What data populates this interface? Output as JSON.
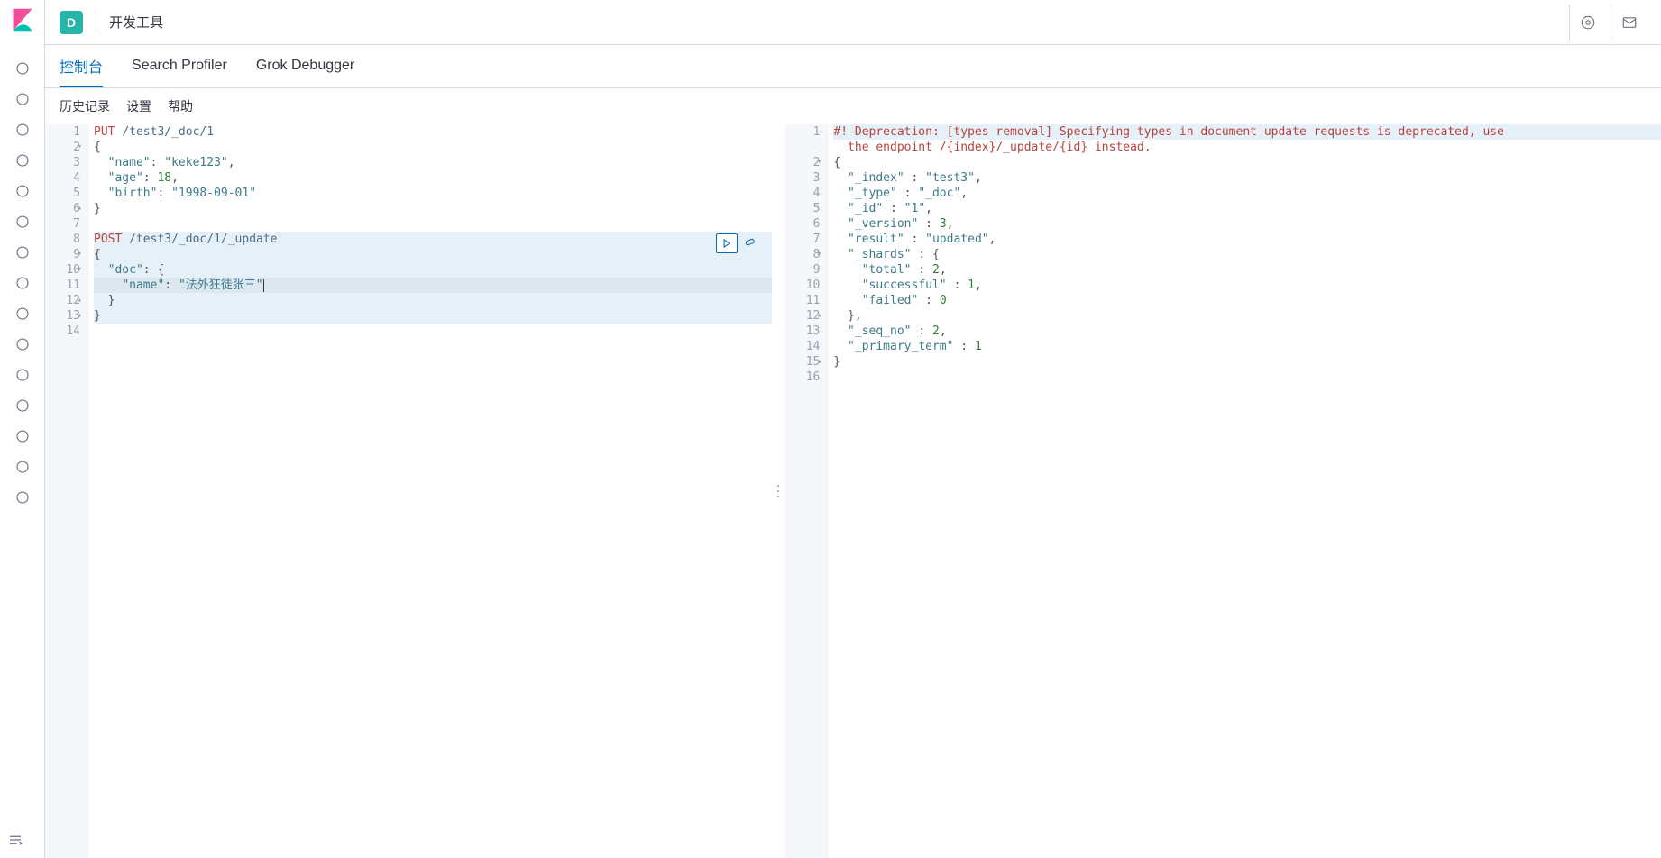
{
  "header": {
    "space_initial": "D",
    "breadcrumb": "开发工具"
  },
  "tabs": [
    {
      "label": "控制台",
      "active": true
    },
    {
      "label": "Search Profiler",
      "active": false
    },
    {
      "label": "Grok Debugger",
      "active": false
    }
  ],
  "subbar": {
    "history": "历史记录",
    "settings": "设置",
    "help": "帮助"
  },
  "editor": {
    "active_block_start": 8,
    "active_block_end": 13,
    "cursor_line": 11,
    "lines": [
      {
        "n": 1,
        "fold": "",
        "tokens": [
          [
            "method",
            "PUT"
          ],
          [
            "text",
            " "
          ],
          [
            "path",
            "/test3/_doc/1"
          ]
        ]
      },
      {
        "n": 2,
        "fold": "▾",
        "tokens": [
          [
            "punct",
            "{"
          ]
        ]
      },
      {
        "n": 3,
        "fold": "",
        "tokens": [
          [
            "text",
            "  "
          ],
          [
            "key",
            "\"name\""
          ],
          [
            "punct",
            ": "
          ],
          [
            "str",
            "\"keke123\""
          ],
          [
            "punct",
            ","
          ]
        ]
      },
      {
        "n": 4,
        "fold": "",
        "tokens": [
          [
            "text",
            "  "
          ],
          [
            "key",
            "\"age\""
          ],
          [
            "punct",
            ": "
          ],
          [
            "num",
            "18"
          ],
          [
            "punct",
            ","
          ]
        ]
      },
      {
        "n": 5,
        "fold": "",
        "tokens": [
          [
            "text",
            "  "
          ],
          [
            "key",
            "\"birth\""
          ],
          [
            "punct",
            ": "
          ],
          [
            "str",
            "\"1998-09-01\""
          ]
        ]
      },
      {
        "n": 6,
        "fold": "▴",
        "tokens": [
          [
            "punct",
            "}"
          ]
        ]
      },
      {
        "n": 7,
        "fold": "",
        "tokens": []
      },
      {
        "n": 8,
        "fold": "",
        "tokens": [
          [
            "method",
            "POST"
          ],
          [
            "text",
            " "
          ],
          [
            "path",
            "/test3/_doc/1/_update"
          ]
        ]
      },
      {
        "n": 9,
        "fold": "▾",
        "tokens": [
          [
            "punct",
            "{"
          ]
        ]
      },
      {
        "n": 10,
        "fold": "▾",
        "tokens": [
          [
            "text",
            "  "
          ],
          [
            "key",
            "\"doc\""
          ],
          [
            "punct",
            ": {"
          ]
        ]
      },
      {
        "n": 11,
        "fold": "",
        "tokens": [
          [
            "text",
            "    "
          ],
          [
            "key",
            "\"name\""
          ],
          [
            "punct",
            ": "
          ],
          [
            "str",
            "\"法外狂徒张三\""
          ]
        ]
      },
      {
        "n": 12,
        "fold": "▴",
        "tokens": [
          [
            "text",
            "  "
          ],
          [
            "punct",
            "}"
          ]
        ]
      },
      {
        "n": 13,
        "fold": "▴",
        "tokens": [
          [
            "punct",
            "}"
          ]
        ]
      },
      {
        "n": 14,
        "fold": "",
        "tokens": []
      }
    ]
  },
  "response": {
    "lines": [
      {
        "n": 1,
        "fold": "",
        "tokens": [
          [
            "err",
            "#! Deprecation: [types removal] Specifying types in document update requests is deprecated, use"
          ]
        ],
        "hl": true
      },
      {
        "n": "",
        "fold": "",
        "tokens": [
          [
            "err",
            "  the endpoint /{index}/_update/{id} instead."
          ]
        ]
      },
      {
        "n": 2,
        "fold": "▾",
        "tokens": [
          [
            "punct",
            "{"
          ]
        ]
      },
      {
        "n": 3,
        "fold": "",
        "tokens": [
          [
            "text",
            "  "
          ],
          [
            "key",
            "\"_index\""
          ],
          [
            "punct",
            " : "
          ],
          [
            "str",
            "\"test3\""
          ],
          [
            "punct",
            ","
          ]
        ]
      },
      {
        "n": 4,
        "fold": "",
        "tokens": [
          [
            "text",
            "  "
          ],
          [
            "key",
            "\"_type\""
          ],
          [
            "punct",
            " : "
          ],
          [
            "str",
            "\"_doc\""
          ],
          [
            "punct",
            ","
          ]
        ]
      },
      {
        "n": 5,
        "fold": "",
        "tokens": [
          [
            "text",
            "  "
          ],
          [
            "key",
            "\"_id\""
          ],
          [
            "punct",
            " : "
          ],
          [
            "str",
            "\"1\""
          ],
          [
            "punct",
            ","
          ]
        ]
      },
      {
        "n": 6,
        "fold": "",
        "tokens": [
          [
            "text",
            "  "
          ],
          [
            "key",
            "\"_version\""
          ],
          [
            "punct",
            " : "
          ],
          [
            "num",
            "3"
          ],
          [
            "punct",
            ","
          ]
        ]
      },
      {
        "n": 7,
        "fold": "",
        "tokens": [
          [
            "text",
            "  "
          ],
          [
            "key",
            "\"result\""
          ],
          [
            "punct",
            " : "
          ],
          [
            "str",
            "\"updated\""
          ],
          [
            "punct",
            ","
          ]
        ]
      },
      {
        "n": 8,
        "fold": "▾",
        "tokens": [
          [
            "text",
            "  "
          ],
          [
            "key",
            "\"_shards\""
          ],
          [
            "punct",
            " : {"
          ]
        ]
      },
      {
        "n": 9,
        "fold": "",
        "tokens": [
          [
            "text",
            "    "
          ],
          [
            "key",
            "\"total\""
          ],
          [
            "punct",
            " : "
          ],
          [
            "num",
            "2"
          ],
          [
            "punct",
            ","
          ]
        ]
      },
      {
        "n": 10,
        "fold": "",
        "tokens": [
          [
            "text",
            "    "
          ],
          [
            "key",
            "\"successful\""
          ],
          [
            "punct",
            " : "
          ],
          [
            "num",
            "1"
          ],
          [
            "punct",
            ","
          ]
        ]
      },
      {
        "n": 11,
        "fold": "",
        "tokens": [
          [
            "text",
            "    "
          ],
          [
            "key",
            "\"failed\""
          ],
          [
            "punct",
            " : "
          ],
          [
            "num",
            "0"
          ]
        ]
      },
      {
        "n": 12,
        "fold": "▴",
        "tokens": [
          [
            "text",
            "  "
          ],
          [
            "punct",
            "},"
          ]
        ]
      },
      {
        "n": 13,
        "fold": "",
        "tokens": [
          [
            "text",
            "  "
          ],
          [
            "key",
            "\"_seq_no\""
          ],
          [
            "punct",
            " : "
          ],
          [
            "num",
            "2"
          ],
          [
            "punct",
            ","
          ]
        ]
      },
      {
        "n": 14,
        "fold": "",
        "tokens": [
          [
            "text",
            "  "
          ],
          [
            "key",
            "\"_primary_term\""
          ],
          [
            "punct",
            " : "
          ],
          [
            "num",
            "1"
          ]
        ]
      },
      {
        "n": 15,
        "fold": "▴",
        "tokens": [
          [
            "punct",
            "}"
          ]
        ]
      },
      {
        "n": 16,
        "fold": "",
        "tokens": []
      }
    ]
  },
  "sidebar_icons": [
    "clock-icon",
    "compass-icon",
    "chart-icon",
    "layers-icon",
    "bank-icon",
    "pin-icon",
    "graph-icon",
    "user-icon",
    "lab-icon",
    "insert-icon",
    "upload-icon",
    "rss-icon",
    "wrench-icon",
    "heartbeat-icon",
    "gear-icon"
  ]
}
